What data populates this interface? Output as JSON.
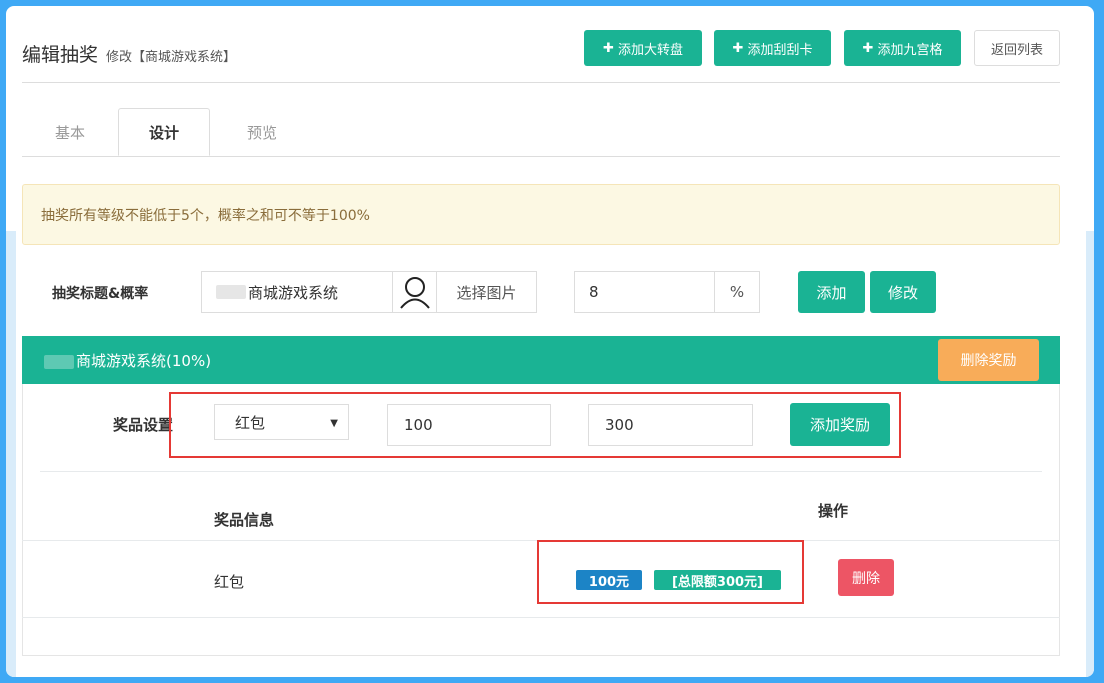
{
  "header": {
    "title": "编辑抽奖",
    "subtitle": "修改【商城游戏系统】",
    "buttons": {
      "add_wheel": "添加大转盘",
      "add_scratch": "添加刮刮卡",
      "add_grid": "添加九宫格",
      "back_list": "返回列表"
    }
  },
  "tabs": [
    "基本",
    "设计",
    "预览"
  ],
  "active_tab": "设计",
  "alert": "抽奖所有等级不能低于5个，概率之和可不等于100%",
  "form": {
    "label": "抽奖标题&概率",
    "title_value": "商城游戏系统",
    "select_image": "选择图片",
    "probability_value": "8",
    "percent_sign": "%",
    "add_button": "添加",
    "edit_button": "修改"
  },
  "panel": {
    "title": "商城游戏系统(10%)",
    "delete_reward_button": "删除奖励",
    "prize_label": "奖品设置",
    "prize_type": "红包",
    "amount_value": "100",
    "total_value": "300",
    "add_reward_button": "添加奖励",
    "table": {
      "col_info": "奖品信息",
      "col_action": "操作",
      "rows": [
        {
          "name": "红包",
          "amount_badge": "100元",
          "limit_badge": "[总限额300元]",
          "delete": "删除"
        }
      ]
    }
  },
  "colors": {
    "primary": "#1ab394",
    "warning": "#f8ac59",
    "danger": "#ed5565",
    "info": "#1c84c6",
    "annotation_red": "#e53935"
  }
}
